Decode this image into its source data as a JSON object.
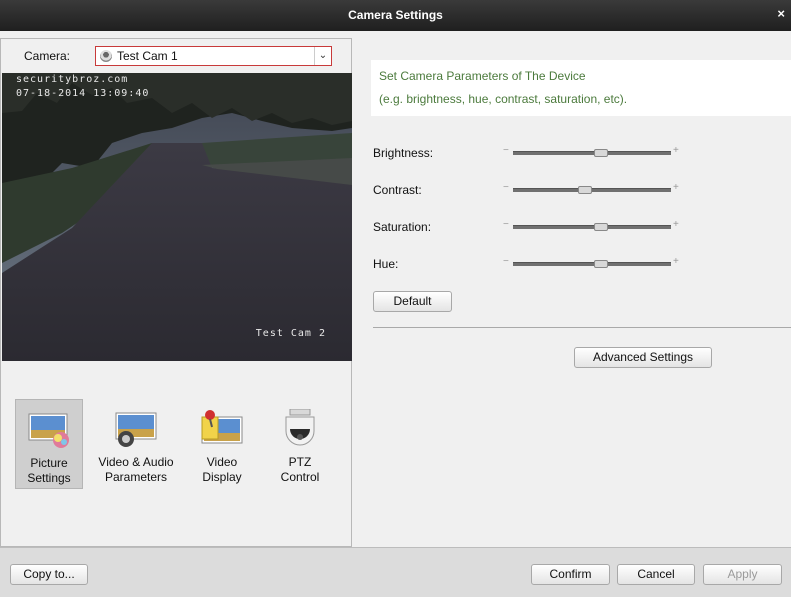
{
  "window": {
    "title": "Camera Settings",
    "close_glyph": "×"
  },
  "camera": {
    "label": "Camera:",
    "selected": "Test Cam 1",
    "icon": "camera-icon"
  },
  "preview": {
    "osd_site": "securitybroz.com",
    "osd_time": "07-18-2014 13:09:40",
    "osd_name": "Test Cam 2"
  },
  "functions": [
    {
      "label_line1": "Picture",
      "label_line2": "Settings",
      "icon": "picture-settings-icon",
      "active": true
    },
    {
      "label_line1": "Video & Audio",
      "label_line2": "Parameters",
      "icon": "video-audio-icon",
      "active": false
    },
    {
      "label_line1": "Video",
      "label_line2": "Display",
      "icon": "video-display-icon",
      "active": false
    },
    {
      "label_line1": "PTZ",
      "label_line2": "Control",
      "icon": "ptz-icon",
      "active": false
    }
  ],
  "info": {
    "line1": "Set Camera Parameters of The Device",
    "line2": "(e.g. brightness, hue, contrast, saturation, etc).",
    "color": "#4b7a3c"
  },
  "sliders": [
    {
      "label": "Brightness:",
      "value": 0.55
    },
    {
      "label": "Contrast:",
      "value": 0.45
    },
    {
      "label": "Saturation:",
      "value": 0.55
    },
    {
      "label": "Hue:",
      "value": 0.55
    }
  ],
  "slider_minus": "−",
  "slider_plus": "+",
  "buttons": {
    "default": "Default",
    "advanced": "Advanced Settings",
    "copy_to": "Copy to...",
    "confirm": "Confirm",
    "cancel": "Cancel",
    "apply": "Apply"
  }
}
